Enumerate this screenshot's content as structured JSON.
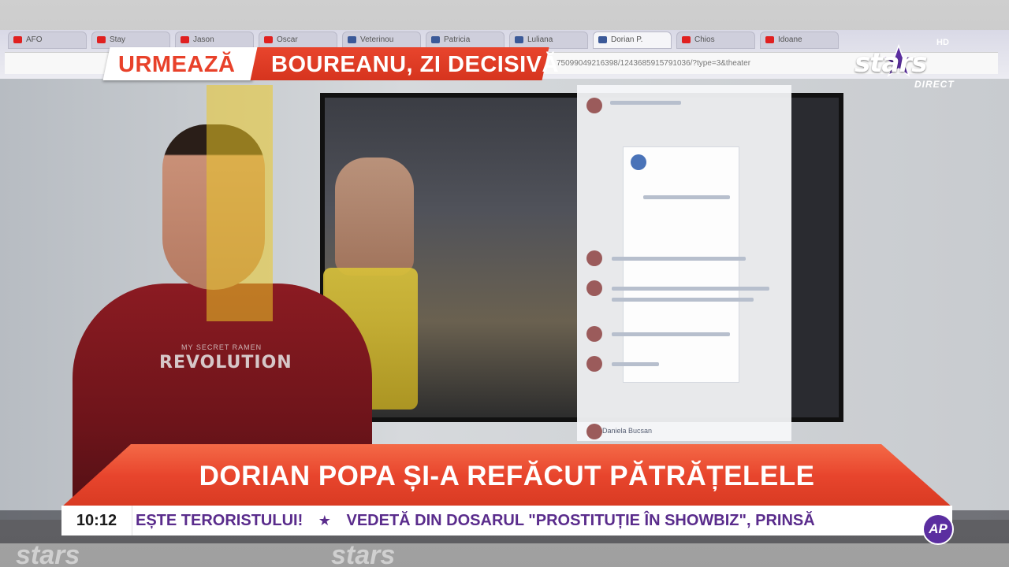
{
  "next": {
    "label": "URMEAZĂ",
    "topic": "BOUREANU, ZI DECISIVĂ"
  },
  "channel": {
    "name": "stars",
    "quality": "HD",
    "status": "DIRECT"
  },
  "headline": "DORIAN POPA ȘI-A REFĂCUT PĂTRĂȚELELE",
  "ticker": {
    "time": "10:12",
    "segment_1": "EȘTE TERORISTULUI!",
    "segment_2": "VEDETĂ DIN DOSARUL \"PROSTITUȚIE ÎN SHOWBIZ\", PRINSĂ"
  },
  "corner_badge": "AP",
  "shirt_print": {
    "small": "MY SECRET RAMEN",
    "big": "REVOLUTION"
  },
  "background_browser": {
    "tabs": [
      "AFO",
      "Stay",
      "Jason",
      "Oscar",
      "Veterinou",
      "Patricia",
      "Luliana",
      "Dorian P.",
      "Chios",
      "Idoane"
    ],
    "url_fragment": "75099049216398/1243685915791036/?type=3&theater"
  },
  "facebook_overlay": {
    "commenter": "Daniela Bucsan"
  },
  "colors": {
    "accent_red": "#e8452d",
    "ticker_purple": "#5a2c8c",
    "badge_purple": "#5b2ea0"
  }
}
